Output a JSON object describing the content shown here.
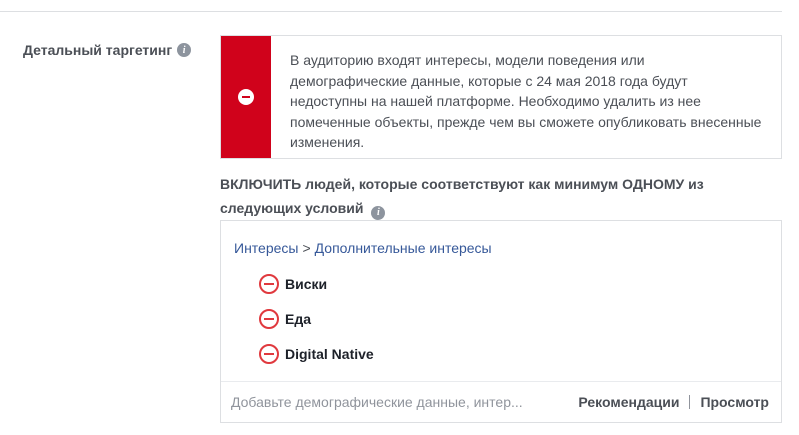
{
  "section": {
    "label": "Детальный таргетинг"
  },
  "error": {
    "message": "В аудиторию входят интересы, модели поведения или демографические данные, которые с 24 мая 2018 года будут недоступны на нашей платформе. Необходимо удалить из нее помеченные объекты, прежде чем вы сможете опубликовать внесенные изменения."
  },
  "include": {
    "heading": "ВКЛЮЧИТЬ людей, которые соответствуют как минимум ОДНОМУ из следующих условий"
  },
  "criteria": {
    "breadcrumb": {
      "category": "Интересы",
      "separator": ">",
      "subcategory": "Дополнительные интересы"
    },
    "items": [
      {
        "label": "Виски"
      },
      {
        "label": "Еда"
      },
      {
        "label": "Digital Native"
      }
    ]
  },
  "search": {
    "placeholder": "Добавьте демографические данные, интер...",
    "recommendations_label": "Рекомендации",
    "browse_label": "Просмотр"
  },
  "colors": {
    "error_red": "#d0021b",
    "remove_red": "#e0393e",
    "link_blue": "#365899",
    "label_gray": "#4b4f56"
  }
}
